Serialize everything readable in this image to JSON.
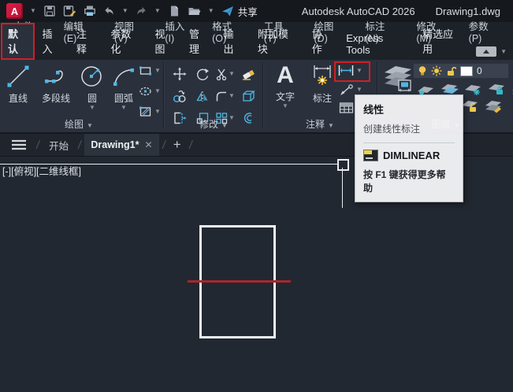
{
  "titlebar": {
    "app_title": "Autodesk AutoCAD 2026",
    "doc_title": "Drawing1.dwg",
    "share_label": "共享"
  },
  "menu_bar": {
    "items": [
      "文件(F)",
      "编辑(E)",
      "视图(V)",
      "插入(I)",
      "格式(O)",
      "工具(T)",
      "绘图(D)",
      "标注(N)",
      "修改(M)",
      "参数(P)"
    ]
  },
  "ribbon": {
    "tabs": [
      "默认",
      "插入",
      "注释",
      "参数化",
      "视图",
      "管理",
      "输出",
      "附加模块",
      "协作",
      "Express Tools",
      "精选应用"
    ],
    "active_tab": "默认",
    "draw_panel": {
      "label": "绘图",
      "line": "直线",
      "polyline": "多段线",
      "circle": "圆",
      "arc": "圆弧"
    },
    "modify_panel": {
      "label": "修改"
    },
    "annotate_panel": {
      "label": "注释",
      "text": "文字",
      "dimension": "标注"
    },
    "layers_panel": {
      "label": "图层",
      "current_layer": "0"
    }
  },
  "file_tabs": {
    "start": "开始",
    "drawing": "Drawing1*"
  },
  "viewport_label": "[-][俯视][二维线框]",
  "tooltip": {
    "title": "线性",
    "description": "创建线性标注",
    "command": "DIMLINEAR",
    "help": "按 F1 键获得更多帮助"
  },
  "icons": {
    "logo_glyph": "A",
    "text_tool_glyph": "A",
    "quick_access": [
      "save",
      "save-as",
      "plot",
      "undo",
      "redo",
      "new-file",
      "open-folder",
      "customize-caret",
      "share-plane"
    ],
    "modify_tools": [
      "move",
      "rotate",
      "trim",
      "erase",
      "copy",
      "mirror",
      "fillet",
      "box-3d",
      "stretch",
      "scale",
      "array",
      "offset"
    ],
    "draw_extra_tools": [
      "rectangle",
      "ellipse",
      "hatch"
    ],
    "annotate_tools": [
      "linear-dimension",
      "leader",
      "table"
    ],
    "layer_tools": [
      "layer-properties",
      "layer-state",
      "make-current",
      "match-layer",
      "freeze",
      "lock",
      "previous-layer",
      "unlock",
      "layer-edit"
    ]
  },
  "colors": {
    "accent_blue": "#4fb6e6",
    "accent_yellow": "#f0c340",
    "annotation_red": "#cf2024",
    "drawing_red_line": "#a5282b",
    "ribbon_bg": "#2a313c",
    "canvas_bg": "#222831"
  }
}
